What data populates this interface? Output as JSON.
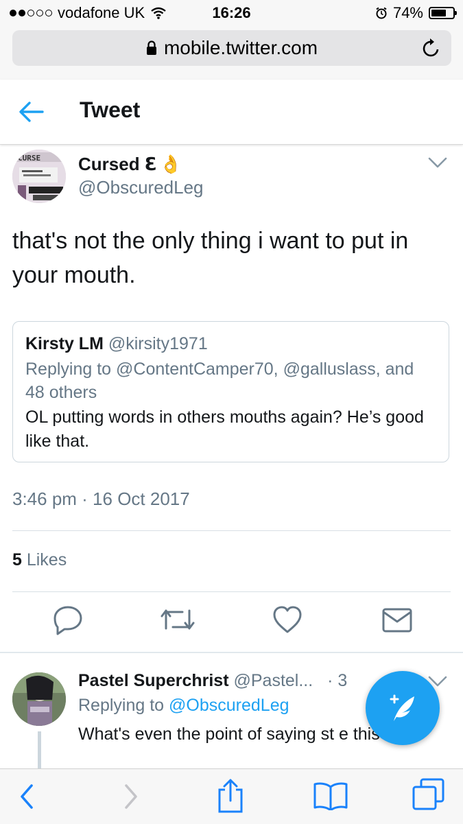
{
  "status_bar": {
    "carrier": "vodafone UK",
    "time": "16:26",
    "battery": "74%",
    "battery_level": 0.74
  },
  "browser": {
    "url": "mobile.twitter.com"
  },
  "header": {
    "title": "Tweet"
  },
  "tweet": {
    "author_name": "Cursed ℇ",
    "author_emoji": "👌",
    "author_handle": "@ObscuredLeg",
    "text": "that's not the only thing i want to put in your mouth.",
    "timestamp": "3:46 pm · 16 Oct 2017",
    "likes_count": "5",
    "likes_label": " Likes",
    "quote": {
      "name": "Kirsty LM",
      "handle": "@kirsity1971",
      "replying_to": "Replying to @ContentCamper70, @galluslass, and 48 others",
      "text": "OL putting words in others mouths again? He’s good like that."
    }
  },
  "reply": {
    "name": "Pastel Superchrist",
    "handle": "@Pastel...",
    "separator": "·",
    "time": "3",
    "replying_prefix": "Replying to ",
    "replying_mention": "@ObscuredLeg",
    "text": "What's even the point of saying st     e this?"
  },
  "colors": {
    "accent": "#1da1f2",
    "secondary_text": "#657786",
    "primary_text": "#14171a",
    "ios_blue": "#1a82fb"
  },
  "icons": {
    "back": "back-arrow-icon",
    "caret": "chevron-down-icon",
    "reply": "reply-icon",
    "retweet": "retweet-icon",
    "like": "heart-icon",
    "message": "envelope-icon",
    "compose": "compose-icon"
  }
}
